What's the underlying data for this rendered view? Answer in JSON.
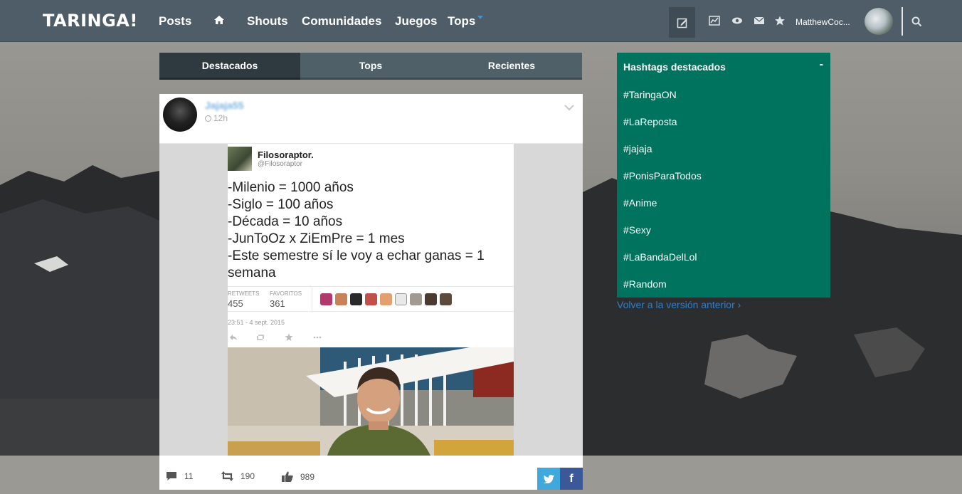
{
  "header": {
    "logo": "TARINGA!",
    "nav": [
      {
        "label": "Posts"
      },
      {
        "label": "Shouts"
      },
      {
        "label": "Comunidades"
      },
      {
        "label": "Juegos"
      },
      {
        "label": "Tops"
      }
    ],
    "username": "MatthewCoc..."
  },
  "feed": {
    "tabs": [
      {
        "label": "Destacados",
        "active": true
      },
      {
        "label": "Tops",
        "active": false
      },
      {
        "label": "Recientes",
        "active": false
      }
    ],
    "post": {
      "author": "Jajaja55",
      "time": "12h",
      "tweet": {
        "name": "Filosoraptor.",
        "handle": "@Filosoraptor",
        "lines": [
          "-Milenio = 1000 años",
          "-Siglo = 100 años",
          "-Década = 10 años",
          "-JunToOz x ZiEmPre = 1 mes",
          "-Este semestre sí le voy a echar ganas  = 1",
          "semana"
        ],
        "retweets_label": "RETWEETS",
        "retweets": "455",
        "favorites_label": "FAVORITOS",
        "favorites": "361",
        "date": "23:51 - 4 sept. 2015"
      },
      "comments": "11",
      "reshares": "190",
      "likes": "989"
    }
  },
  "sidebar": {
    "title": "Hashtags destacados",
    "collapse": "-",
    "hashtags": [
      "#TaringaON",
      "#LaReposta",
      "#jajaja",
      "#PonisParaTodos",
      "#Anime",
      "#Sexy",
      "#LaBandaDelLol",
      "#Random"
    ],
    "prev_version": "Volver a la versión anterior ›"
  },
  "colors": {
    "topbar": "#4e5d67",
    "sidebar": "#00735e",
    "link": "#2f7fc8",
    "twitter": "#3fa9de",
    "facebook": "#3b5998"
  }
}
